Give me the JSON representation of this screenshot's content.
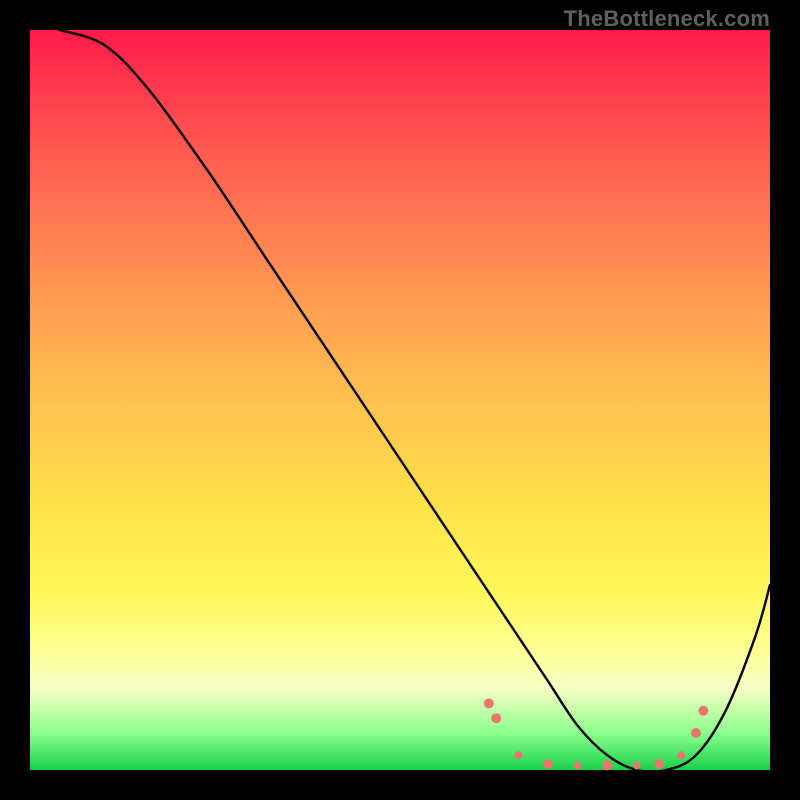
{
  "watermark": "TheBottleneck.com",
  "chart_data": {
    "type": "line",
    "title": "",
    "xlabel": "",
    "ylabel": "",
    "xlim": [
      0,
      100
    ],
    "ylim": [
      0,
      100
    ],
    "series": [
      {
        "name": "curve",
        "x": [
          4,
          10,
          16,
          24,
          32,
          40,
          48,
          56,
          62,
          66,
          70,
          74,
          78,
          82,
          86,
          90,
          94,
          98,
          100
        ],
        "y": [
          100,
          98,
          92,
          81,
          69,
          57,
          45,
          33,
          24,
          18,
          12,
          6,
          2,
          0,
          0,
          2,
          8,
          18,
          25
        ]
      }
    ],
    "markers": {
      "name": "dots",
      "color": "#e8766d",
      "x": [
        62,
        63,
        66,
        70,
        74,
        78,
        82,
        85,
        88,
        90,
        91
      ],
      "y": [
        9,
        7,
        2,
        0.8,
        0.6,
        0.6,
        0.6,
        0.8,
        2,
        5,
        8
      ],
      "r": [
        5,
        5,
        4,
        5,
        4,
        5,
        4,
        5,
        4,
        5,
        5
      ]
    }
  }
}
